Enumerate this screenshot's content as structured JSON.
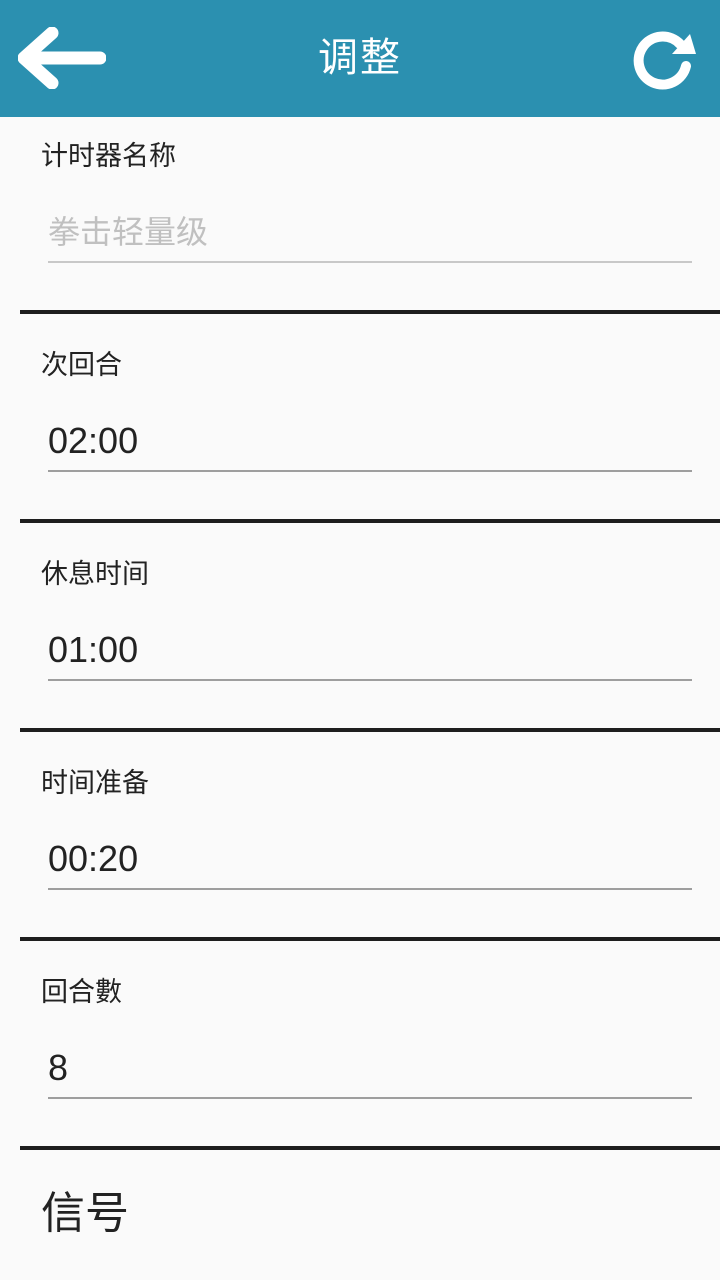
{
  "header": {
    "title": "调整",
    "back_icon": "arrow-left-icon",
    "refresh_icon": "refresh-icon",
    "background_color": "#2b90b0"
  },
  "fields": [
    {
      "label": "计时器名称",
      "value": "",
      "placeholder": "拳击轻量级"
    },
    {
      "label": "次回合",
      "value": "02:00",
      "placeholder": ""
    },
    {
      "label": "休息时间",
      "value": "01:00",
      "placeholder": ""
    },
    {
      "label": "时间准备",
      "value": "00:20",
      "placeholder": ""
    },
    {
      "label": "回合數",
      "value": "8",
      "placeholder": ""
    }
  ],
  "signal": {
    "label": "信号"
  }
}
